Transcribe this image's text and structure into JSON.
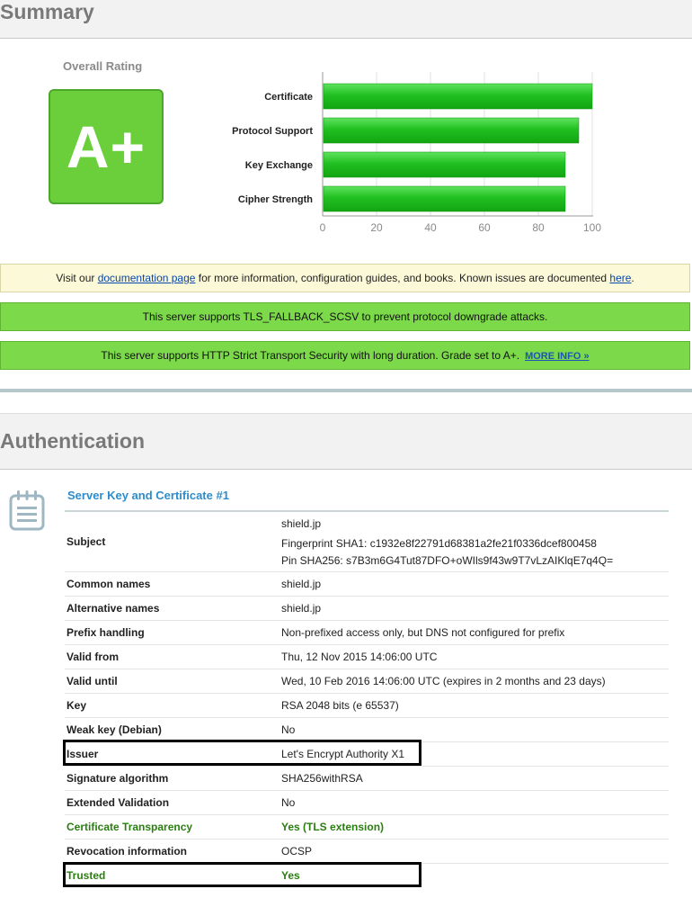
{
  "summary": {
    "title": "Summary",
    "overall_rating_label": "Overall Rating",
    "grade": "A+"
  },
  "chart_data": {
    "type": "bar",
    "orientation": "horizontal",
    "categories": [
      "Certificate",
      "Protocol Support",
      "Key Exchange",
      "Cipher Strength"
    ],
    "values": [
      100,
      95,
      90,
      90
    ],
    "xlim": [
      0,
      100
    ],
    "ticks": [
      0,
      20,
      40,
      60,
      80,
      100
    ],
    "bar_color": "#1fb81f",
    "grid": true
  },
  "banners": {
    "docs": {
      "pre": "Visit our ",
      "link1": "documentation page",
      "mid": " for more information, configuration guides, and books. Known issues are documented ",
      "link2": "here",
      "post": "."
    },
    "fallback": "This server supports TLS_FALLBACK_SCSV to prevent protocol downgrade attacks.",
    "hsts": "This server supports HTTP Strict Transport Security with long duration. Grade set to A+.",
    "hsts_more": "MORE INFO »"
  },
  "auth": {
    "title": "Authentication",
    "cert_title": "Server Key and Certificate #1",
    "icon": "certificate-icon",
    "subject": {
      "label": "Subject",
      "value": "shield.jp",
      "fingerprint": "Fingerprint SHA1: c1932e8f22791d68381a2fe21f0336dcef800458",
      "pin": "Pin SHA256: s7B3m6G4Tut87DFO+oWIls9f43w9T7vLzAIKlqE7q4Q="
    },
    "rows": [
      {
        "label": "Common names",
        "value": "shield.jp"
      },
      {
        "label": "Alternative names",
        "value": "shield.jp"
      },
      {
        "label": "Prefix handling",
        "value": "Non-prefixed access only, but DNS not configured for prefix"
      },
      {
        "label": "Valid from",
        "value": "Thu, 12 Nov 2015 14:06:00 UTC"
      },
      {
        "label": "Valid until",
        "value": "Wed, 10 Feb 2016 14:06:00 UTC (expires in 2 months and 23 days)"
      },
      {
        "label": "Key",
        "value": "RSA 2048 bits (e 65537)"
      },
      {
        "label": "Weak key (Debian)",
        "value": "No"
      },
      {
        "label": "Issuer",
        "value": "Let's Encrypt Authority X1"
      },
      {
        "label": "Signature algorithm",
        "value": "SHA256withRSA"
      },
      {
        "label": "Extended Validation",
        "value": "No"
      },
      {
        "label": "Certificate Transparency",
        "value": "Yes (TLS extension)"
      },
      {
        "label": "Revocation information",
        "value": "OCSP"
      },
      {
        "label": "Trusted",
        "value": "Yes"
      }
    ]
  }
}
